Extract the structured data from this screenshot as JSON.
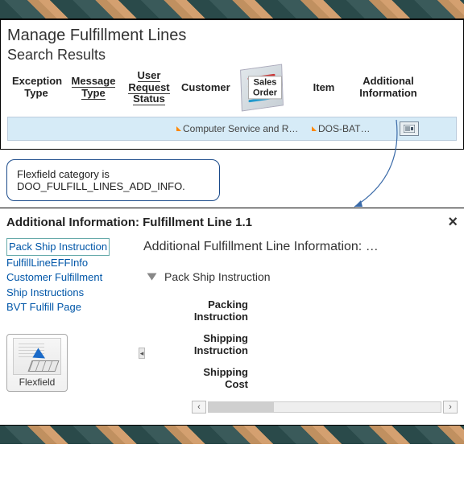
{
  "header": {
    "title": "Manage Fulfillment Lines",
    "subtitle": "Search Results",
    "columns": {
      "exception": "Exception\nType",
      "message": "Message\nType",
      "user_req": "User\nRequest\nStatus",
      "customer": "Customer",
      "sales_order": "Sales\nOrder",
      "item": "Item",
      "addl": "Additional\nInformation"
    }
  },
  "row": {
    "customer": "Computer Service and R…",
    "item": "DOS-BAT…"
  },
  "callout": {
    "line1": "Flexfield category is",
    "line2": "DOO_FULFILL_LINES_ADD_INFO."
  },
  "detail": {
    "heading": "Additional Information: Fulfillment Line 1.1",
    "links": [
      "Pack Ship Instruction",
      "FulfillLineEFFInfo",
      "Customer Fulfillment",
      "Ship Instructions",
      "BVT Fulfill Page"
    ],
    "flexfield_label": "Flexfield",
    "subheading": "Additional Fulfillment Line Information: …",
    "section": "Pack Ship Instruction",
    "fields": {
      "packing": "Packing Instruction",
      "shipping": "Shipping Instruction",
      "cost": "Shipping Cost"
    }
  }
}
